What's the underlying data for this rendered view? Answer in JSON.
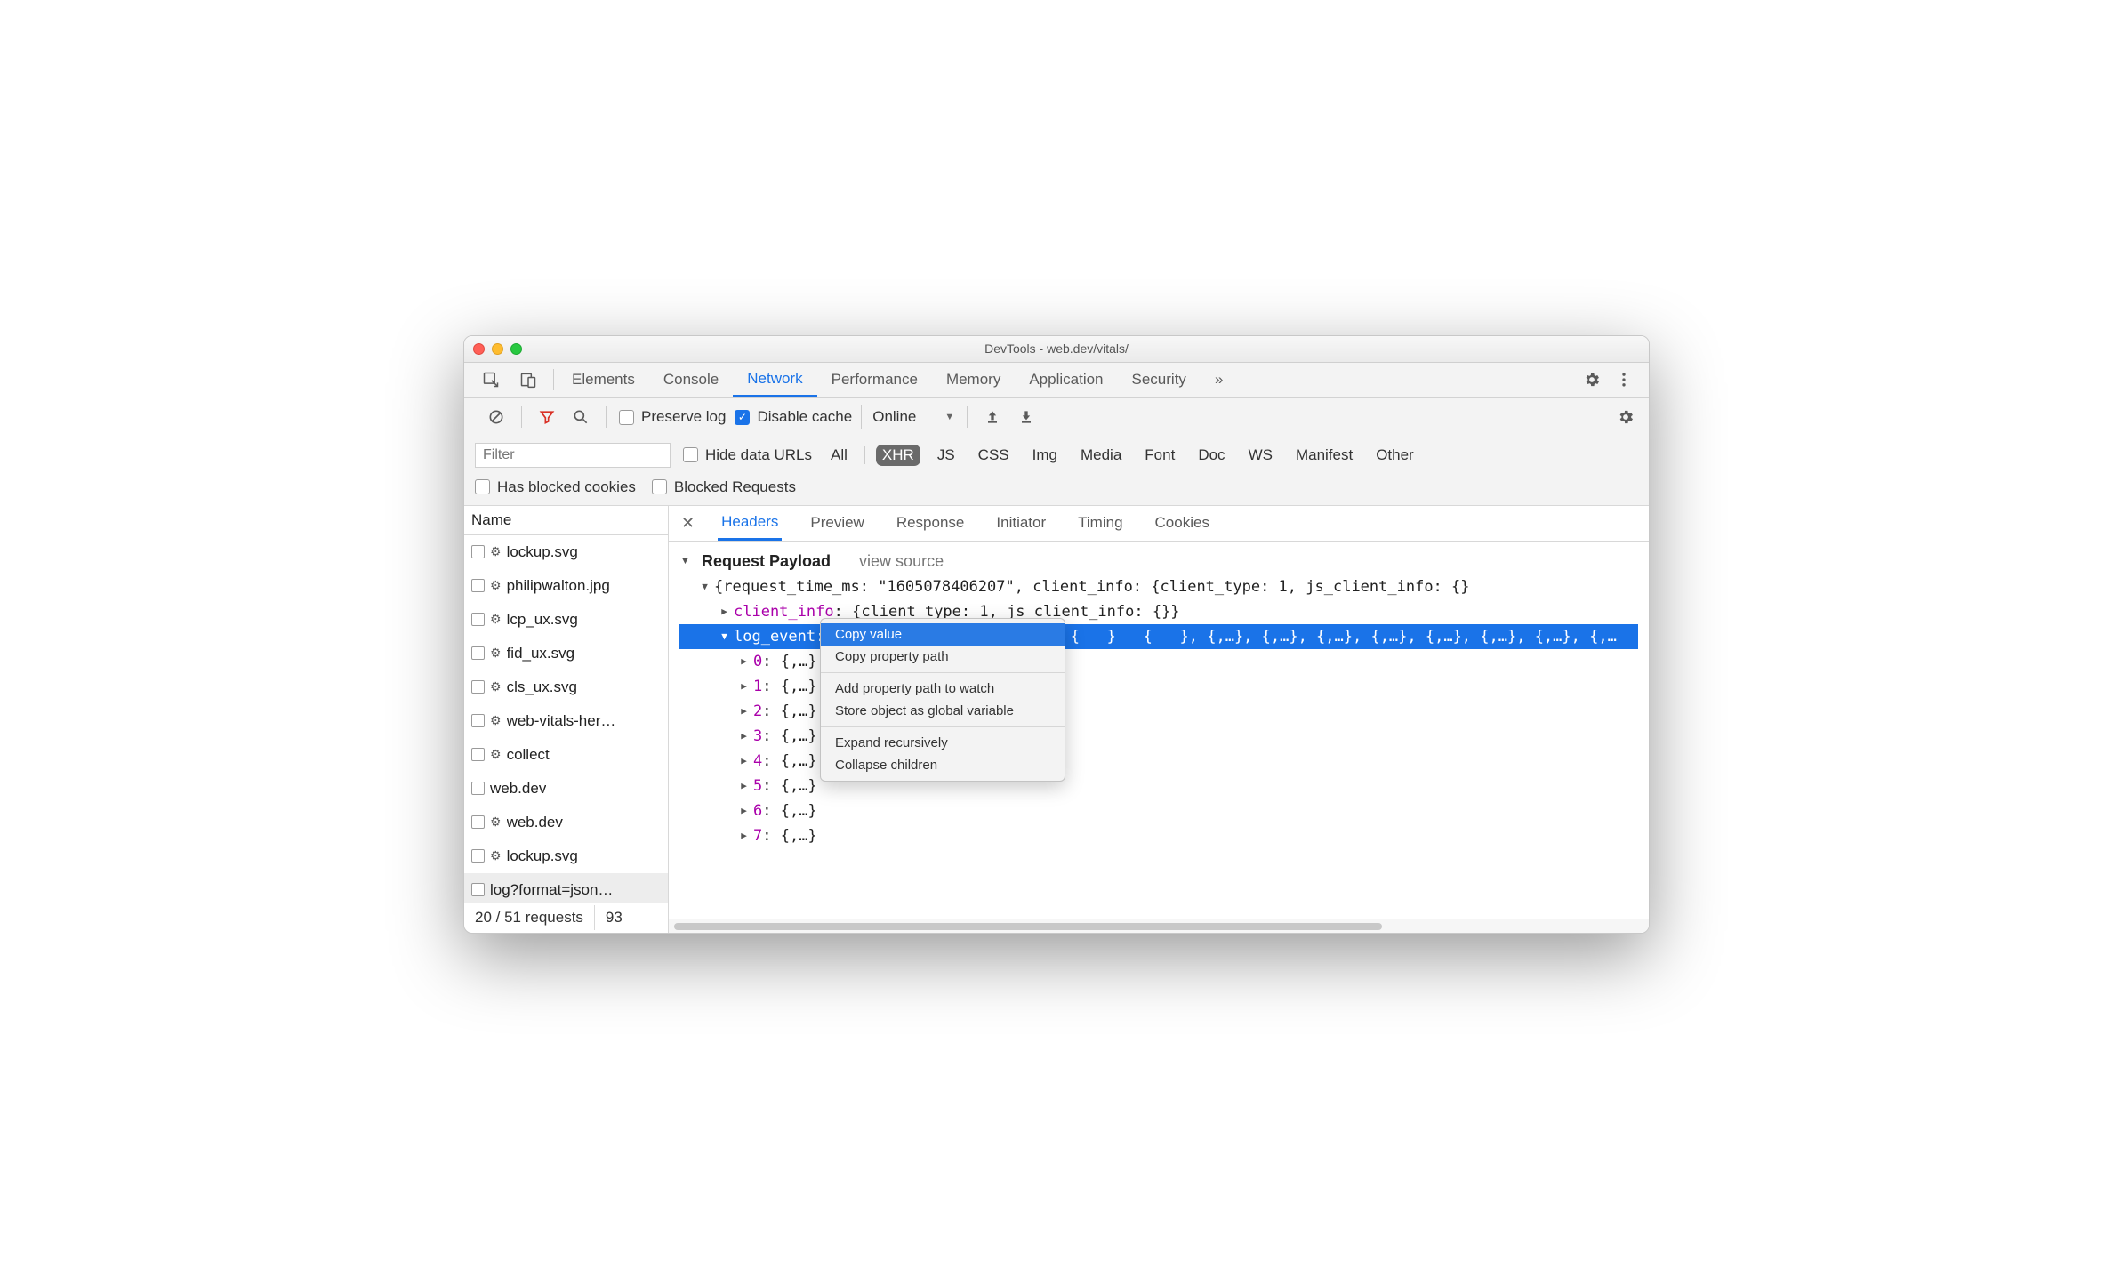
{
  "window": {
    "title": "DevTools - web.dev/vitals/"
  },
  "main_tabs": {
    "items": [
      "Elements",
      "Console",
      "Network",
      "Performance",
      "Memory",
      "Application",
      "Security"
    ],
    "active": "Network",
    "overflow": "»"
  },
  "net_toolbar": {
    "preserve_log": {
      "label": "Preserve log",
      "checked": false
    },
    "disable_cache": {
      "label": "Disable cache",
      "checked": true
    },
    "throttling": {
      "value": "Online"
    }
  },
  "filter": {
    "placeholder": "Filter",
    "hide_data_urls": {
      "label": "Hide data URLs",
      "checked": false
    },
    "types": [
      "All",
      "XHR",
      "JS",
      "CSS",
      "Img",
      "Media",
      "Font",
      "Doc",
      "WS",
      "Manifest",
      "Other"
    ],
    "active_type": "XHR",
    "has_blocked_cookies": {
      "label": "Has blocked cookies",
      "checked": false
    },
    "blocked_requests": {
      "label": "Blocked Requests",
      "checked": false
    }
  },
  "requests": {
    "header": "Name",
    "items": [
      {
        "name": "lockup.svg",
        "gear": true
      },
      {
        "name": "philipwalton.jpg",
        "gear": true
      },
      {
        "name": "lcp_ux.svg",
        "gear": true
      },
      {
        "name": "fid_ux.svg",
        "gear": true
      },
      {
        "name": "cls_ux.svg",
        "gear": true
      },
      {
        "name": "web-vitals-her…",
        "gear": true
      },
      {
        "name": "collect",
        "gear": true
      },
      {
        "name": "web.dev",
        "gear": false
      },
      {
        "name": "web.dev",
        "gear": true
      },
      {
        "name": "lockup.svg",
        "gear": true
      },
      {
        "name": "log?format=json…",
        "gear": false,
        "selected": true
      }
    ],
    "status": {
      "requests": "20 / 51 requests",
      "bytes": "93"
    }
  },
  "detail_tabs": {
    "items": [
      "Headers",
      "Preview",
      "Response",
      "Initiator",
      "Timing",
      "Cookies"
    ],
    "active": "Headers"
  },
  "payload": {
    "section": "Request Payload",
    "view_source": "view source",
    "root": "{request_time_ms: \"1605078406207\", client_info: {client_type: 1, js_client_info: {}",
    "client_info_key": "client_info",
    "client_info_val": "{client_type: 1, js_client_info: {}}",
    "log_event_key": "log_event",
    "log_event_tail": ", {,…}, {,…}, {,…}, {,…}, {,…}, {,…}, {,…}, {,…",
    "children": [
      {
        "key": "0",
        "val": "{,…}"
      },
      {
        "key": "1",
        "val": "{,…}"
      },
      {
        "key": "2",
        "val": "{,…}"
      },
      {
        "key": "3",
        "val": "{,…}"
      },
      {
        "key": "4",
        "val": "{,…}"
      },
      {
        "key": "5",
        "val": "{,…}"
      },
      {
        "key": "6",
        "val": "{,…}"
      },
      {
        "key": "7",
        "val": "{,…}"
      }
    ]
  },
  "context_menu": {
    "items": [
      "Copy value",
      "Copy property path",
      "---",
      "Add property path to watch",
      "Store object as global variable",
      "---",
      "Expand recursively",
      "Collapse children"
    ],
    "selected": "Copy value"
  }
}
